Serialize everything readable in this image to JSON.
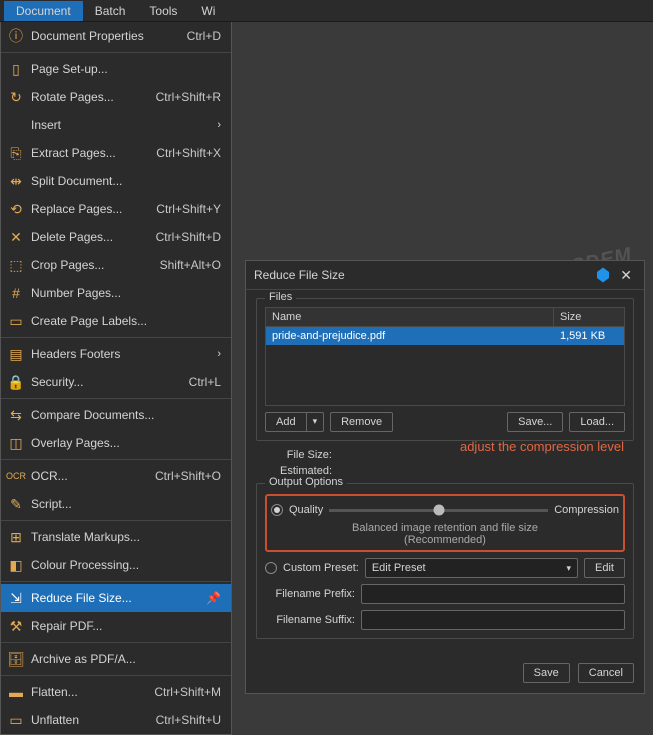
{
  "menubar": {
    "document": "Document",
    "batch": "Batch",
    "tools": "Tools",
    "win": "Wi"
  },
  "menu": {
    "docprops": {
      "label": "Document Properties",
      "shortcut": "Ctrl+D"
    },
    "pagesetup": {
      "label": "Page Set-up..."
    },
    "rotate": {
      "label": "Rotate Pages...",
      "shortcut": "Ctrl+Shift+R"
    },
    "insert": {
      "label": "Insert"
    },
    "extract": {
      "label": "Extract Pages...",
      "shortcut": "Ctrl+Shift+X"
    },
    "split": {
      "label": "Split Document..."
    },
    "replace": {
      "label": "Replace Pages...",
      "shortcut": "Ctrl+Shift+Y"
    },
    "delete": {
      "label": "Delete Pages...",
      "shortcut": "Ctrl+Shift+D"
    },
    "crop": {
      "label": "Crop Pages...",
      "shortcut": "Shift+Alt+O"
    },
    "number": {
      "label": "Number Pages..."
    },
    "pagelabels": {
      "label": "Create Page Labels..."
    },
    "headers": {
      "label": "Headers  Footers"
    },
    "security": {
      "label": "Security...",
      "shortcut": "Ctrl+L"
    },
    "compare": {
      "label": "Compare Documents..."
    },
    "overlay": {
      "label": "Overlay Pages..."
    },
    "ocr": {
      "label": "OCR...",
      "shortcut": "Ctrl+Shift+O"
    },
    "script": {
      "label": "Script..."
    },
    "translate": {
      "label": "Translate Markups..."
    },
    "colour": {
      "label": "Colour Processing..."
    },
    "reduce": {
      "label": "Reduce File Size..."
    },
    "repair": {
      "label": "Repair PDF..."
    },
    "archive": {
      "label": "Archive as PDF/A..."
    },
    "flatten": {
      "label": "Flatten...",
      "shortcut": "Ctrl+Shift+M"
    },
    "unflatten": {
      "label": "Unflatten",
      "shortcut": "Ctrl+Shift+U"
    }
  },
  "watermark": "CISDEM",
  "dialog": {
    "title": "Reduce File Size",
    "files_group": "Files",
    "name_col": "Name",
    "size_col": "Size",
    "file_name": "pride-and-prejudice.pdf",
    "file_size": "1,591 KB",
    "add": "Add",
    "remove": "Remove",
    "save": "Save...",
    "load": "Load...",
    "filesize_label": "File Size:",
    "estimated_label": "Estimated:",
    "output_group": "Output Options",
    "quality": "Quality",
    "compression": "Compression",
    "slider_caption": "Balanced image retention and file size",
    "slider_sub": "(Recommended)",
    "custom_preset": "Custom Preset:",
    "edit_preset": "Edit Preset",
    "edit": "Edit",
    "prefix": "Filename Prefix:",
    "suffix": "Filename Suffix:",
    "save_btn": "Save",
    "cancel_btn": "Cancel"
  },
  "annotation": "adjust the compression level"
}
